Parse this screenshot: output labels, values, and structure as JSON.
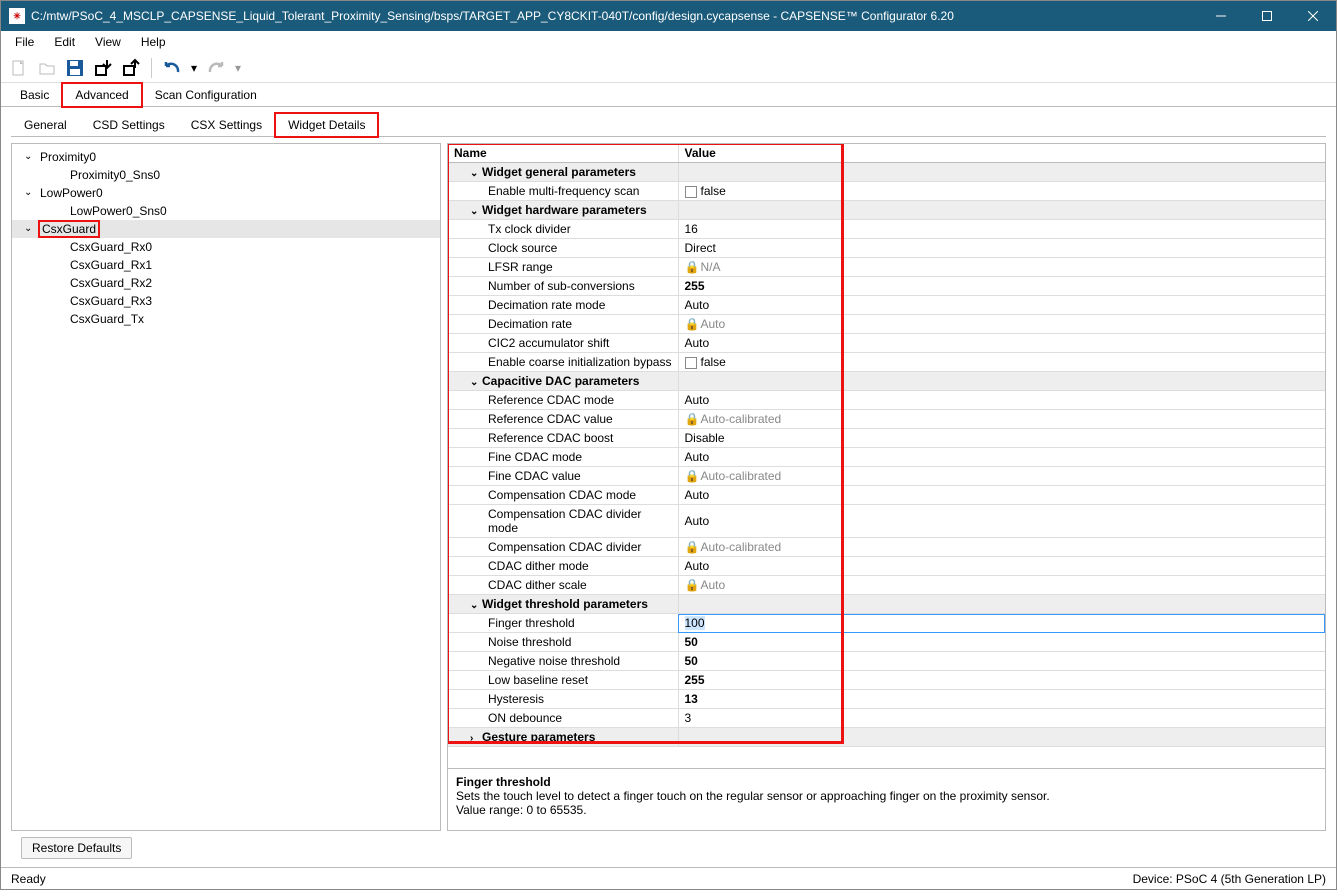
{
  "window": {
    "title": "C:/mtw/PSoC_4_MSCLP_CAPSENSE_Liquid_Tolerant_Proximity_Sensing/bsps/TARGET_APP_CY8CKIT-040T/config/design.cycapsense - CAPSENSE™ Configurator 6.20"
  },
  "menubar": [
    "File",
    "Edit",
    "View",
    "Help"
  ],
  "tabs_main": {
    "items": [
      "Basic",
      "Advanced",
      "Scan Configuration"
    ],
    "active": "Advanced",
    "highlight": "Advanced"
  },
  "tabs_sub": {
    "items": [
      "General",
      "CSD Settings",
      "CSX Settings",
      "Widget Details"
    ],
    "active": "Widget Details",
    "highlight": "Widget Details"
  },
  "tree": [
    {
      "label": "Proximity0",
      "level": 0,
      "expanded": true
    },
    {
      "label": "Proximity0_Sns0",
      "level": 1
    },
    {
      "label": "LowPower0",
      "level": 0,
      "expanded": true
    },
    {
      "label": "LowPower0_Sns0",
      "level": 1
    },
    {
      "label": "CsxGuard",
      "level": 0,
      "expanded": true,
      "selected": true,
      "highlight": true
    },
    {
      "label": "CsxGuard_Rx0",
      "level": 1
    },
    {
      "label": "CsxGuard_Rx1",
      "level": 1
    },
    {
      "label": "CsxGuard_Rx2",
      "level": 1
    },
    {
      "label": "CsxGuard_Rx3",
      "level": 1
    },
    {
      "label": "CsxGuard_Tx",
      "level": 1
    }
  ],
  "grid": {
    "headers": {
      "name": "Name",
      "value": "Value"
    },
    "groups": [
      {
        "title": "Widget general parameters",
        "expanded": true,
        "rows": [
          {
            "name": "Enable multi-frequency scan",
            "value": "false",
            "checkbox": true
          }
        ]
      },
      {
        "title": "Widget hardware parameters",
        "expanded": true,
        "rows": [
          {
            "name": "Tx clock divider",
            "value": "16"
          },
          {
            "name": "Clock source",
            "value": "Direct"
          },
          {
            "name": "LFSR range",
            "value": "N/A",
            "locked": true
          },
          {
            "name": "Number of sub-conversions",
            "value": "255",
            "bold": true
          },
          {
            "name": "Decimation rate mode",
            "value": "Auto"
          },
          {
            "name": "Decimation rate",
            "value": "Auto",
            "locked": true
          },
          {
            "name": "CIC2 accumulator shift",
            "value": "Auto"
          },
          {
            "name": "Enable coarse initialization bypass",
            "value": "false",
            "checkbox": true
          }
        ]
      },
      {
        "title": "Capacitive DAC parameters",
        "expanded": true,
        "rows": [
          {
            "name": "Reference CDAC mode",
            "value": "Auto"
          },
          {
            "name": "Reference CDAC value",
            "value": "Auto-calibrated",
            "locked": true
          },
          {
            "name": "Reference CDAC boost",
            "value": "Disable"
          },
          {
            "name": "Fine CDAC mode",
            "value": "Auto"
          },
          {
            "name": "Fine CDAC value",
            "value": "Auto-calibrated",
            "locked": true
          },
          {
            "name": "Compensation CDAC mode",
            "value": "Auto"
          },
          {
            "name": "Compensation CDAC divider mode",
            "value": "Auto"
          },
          {
            "name": "Compensation CDAC divider",
            "value": "Auto-calibrated",
            "locked": true
          },
          {
            "name": "CDAC dither mode",
            "value": "Auto"
          },
          {
            "name": "CDAC dither scale",
            "value": "Auto",
            "locked": true
          }
        ]
      },
      {
        "title": "Widget threshold parameters",
        "expanded": true,
        "rows": [
          {
            "name": "Finger threshold",
            "value": "100",
            "editing": true
          },
          {
            "name": "Noise threshold",
            "value": "50",
            "bold": true
          },
          {
            "name": "Negative noise threshold",
            "value": "50",
            "bold": true
          },
          {
            "name": "Low baseline reset",
            "value": "255",
            "bold": true
          },
          {
            "name": "Hysteresis",
            "value": "13",
            "bold": true
          },
          {
            "name": "ON debounce",
            "value": "3"
          }
        ]
      },
      {
        "title": "Gesture parameters",
        "expanded": false,
        "rows": []
      }
    ]
  },
  "description": {
    "title": "Finger threshold",
    "line1": "Sets the touch level to detect a finger touch on the regular sensor or approaching finger on the proximity sensor.",
    "line2": "Value range: 0 to 65535."
  },
  "restore_button": "Restore Defaults",
  "statusbar": {
    "left": "Ready",
    "right": "Device: PSoC 4 (5th Generation LP)"
  }
}
